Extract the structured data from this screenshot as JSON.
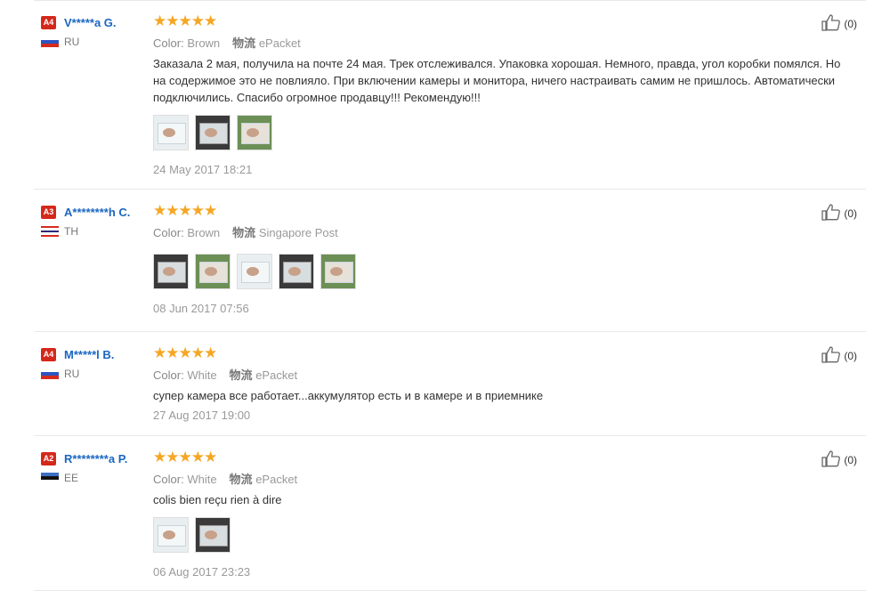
{
  "feedback": [
    {
      "level": "A4",
      "user": "V*****a G.",
      "country": "RU",
      "flag": [
        "#ffffff",
        "#2c54c2",
        "#d52b1e"
      ],
      "color_label": "Color:",
      "color_value": "Brown",
      "ship_label": "物流",
      "ship_value": "ePacket",
      "text": "Заказала 2 мая, получила на почте 24 мая. Трек отслеживался. Упаковка хорошая. Немного, правда, угол коробки помялся. Но на содержимое это не повлияло. При включении камеры и монитора, ничего настраивать самим не пришлось. Автоматически подключились. Спасибо огромное продавцу!!! Рекомендую!!!",
      "photos": 3,
      "date": "24 May 2017 18:21",
      "likes": "(0)"
    },
    {
      "level": "A3",
      "user": "A********h C.",
      "country": "TH",
      "flag": [
        "#d52b1e",
        "#ffffff",
        "#2d2a7a",
        "#ffffff",
        "#d52b1e"
      ],
      "color_label": "Color:",
      "color_value": "Brown",
      "ship_label": "物流",
      "ship_value": "Singapore Post",
      "text": "",
      "photos": 5,
      "date": "08 Jun 2017 07:56",
      "likes": "(0)"
    },
    {
      "level": "A4",
      "user": "M*****l B.",
      "country": "RU",
      "flag": [
        "#ffffff",
        "#2c54c2",
        "#d52b1e"
      ],
      "color_label": "Color:",
      "color_value": "White",
      "ship_label": "物流",
      "ship_value": "ePacket",
      "text": "супер камера все работает...аккумулятор есть и в камере и в приемнике",
      "photos": 0,
      "date": "27 Aug 2017 19:00",
      "likes": "(0)"
    },
    {
      "level": "A2",
      "user": "R********a P.",
      "country": "EE",
      "flag": [
        "#3a6fc4",
        "#111111",
        "#ffffff"
      ],
      "color_label": "Color:",
      "color_value": "White",
      "ship_label": "物流",
      "ship_value": "ePacket",
      "text": "colis bien reçu rien à dire",
      "photos": 2,
      "date": "06 Aug 2017 23:23",
      "likes": "(0)"
    }
  ],
  "colors": {
    "star": "#f5a623",
    "username": "#1a66c2",
    "badge": "#d4281b"
  }
}
